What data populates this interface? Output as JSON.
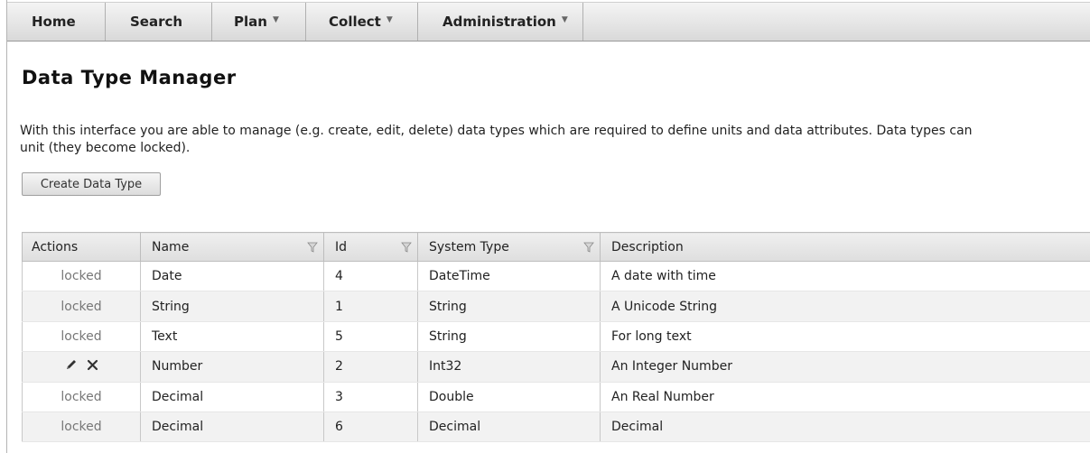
{
  "navbar": {
    "items": [
      {
        "label": "Home",
        "dropdown": false
      },
      {
        "label": "Search",
        "dropdown": false
      },
      {
        "label": "Plan",
        "dropdown": true
      },
      {
        "label": "Collect",
        "dropdown": true
      },
      {
        "label": "Administration",
        "dropdown": true
      }
    ]
  },
  "page": {
    "title": "Data Type Manager",
    "intro_line1": "With this interface you are able to manage (e.g. create, edit, delete) data types which are required to define units and data attributes. Data types can",
    "intro_line2": "unit (they become locked).",
    "create_button": "Create Data Type"
  },
  "table": {
    "columns": [
      "Actions",
      "Name",
      "Id",
      "System Type",
      "Description"
    ],
    "rows": [
      {
        "actions": "locked",
        "name": "Date",
        "id": "4",
        "system_type": "DateTime",
        "description": "A date with time"
      },
      {
        "actions": "locked",
        "name": "String",
        "id": "1",
        "system_type": "String",
        "description": "A Unicode String"
      },
      {
        "actions": "locked",
        "name": "Text",
        "id": "5",
        "system_type": "String",
        "description": "For long text"
      },
      {
        "actions": "",
        "editable": true,
        "name": "Number",
        "id": "2",
        "system_type": "Int32",
        "description": "An Integer Number"
      },
      {
        "actions": "locked",
        "name": "Decimal",
        "id": "3",
        "system_type": "Double",
        "description": "An Real Number"
      },
      {
        "actions": "locked",
        "name": "Decimal",
        "id": "6",
        "system_type": "Decimal",
        "description": "Decimal"
      }
    ]
  },
  "icons": {
    "filter": "filter-icon",
    "edit": "pencil-icon",
    "delete": "close-icon",
    "dropdown": "caret-down-icon"
  }
}
